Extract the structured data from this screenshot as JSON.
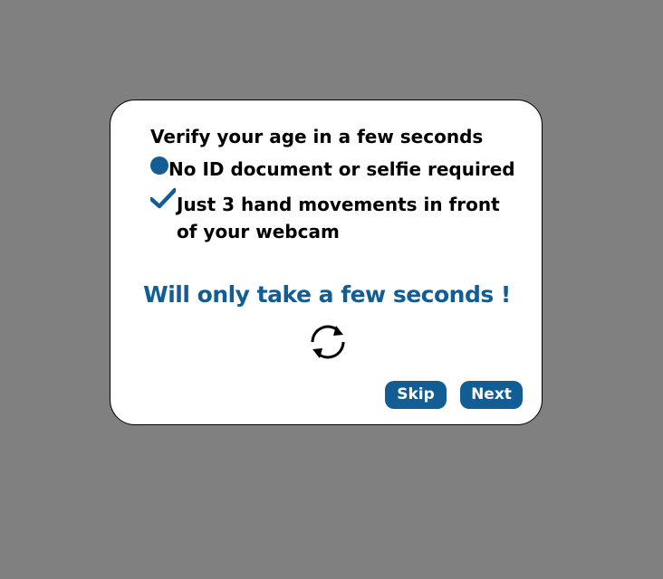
{
  "dialog": {
    "heading": "Verify your age in a few seconds",
    "features": [
      {
        "icon": "dot-icon",
        "text": "No ID document or selfie required"
      },
      {
        "icon": "check-icon",
        "text": "Just 3 hand movements in front of your webcam"
      }
    ],
    "tagline": "Will only take a few seconds !",
    "refresh_icon": "refresh-icon",
    "buttons": {
      "skip": "Skip",
      "next": "Next"
    }
  },
  "colors": {
    "backdrop": "#808080",
    "accent": "#135d95",
    "dialog_bg": "#ffffff"
  }
}
